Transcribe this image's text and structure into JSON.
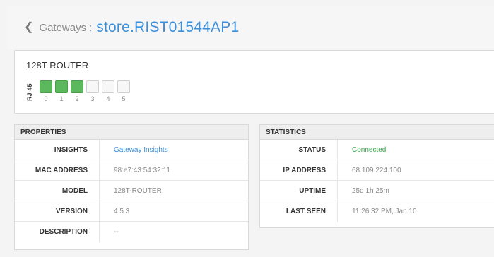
{
  "header": {
    "breadcrumb": "Gateways",
    "separator": ":",
    "gateway_name": "store.RIST01544AP1"
  },
  "router": {
    "title": "128T-ROUTER",
    "interface_label": "RJ-45",
    "ports": [
      {
        "number": "0",
        "status": "up"
      },
      {
        "number": "1",
        "status": "up"
      },
      {
        "number": "2",
        "status": "up"
      },
      {
        "number": "3",
        "status": "down"
      },
      {
        "number": "4",
        "status": "down"
      },
      {
        "number": "5",
        "status": "down"
      }
    ]
  },
  "properties": {
    "title": "PROPERTIES",
    "rows": [
      {
        "key": "INSIGHTS",
        "value": "Gateway Insights"
      },
      {
        "key": "MAC ADDRESS",
        "value": "98:e7:43:54:32:11"
      },
      {
        "key": "MODEL",
        "value": "128T-ROUTER"
      },
      {
        "key": "VERSION",
        "value": "4.5.3"
      },
      {
        "key": "DESCRIPTION",
        "value": "--"
      }
    ]
  },
  "statistics": {
    "title": "STATISTICS",
    "rows": [
      {
        "key": "STATUS",
        "value": "Connected"
      },
      {
        "key": "IP ADDRESS",
        "value": "68.109.224.100"
      },
      {
        "key": "UPTIME",
        "value": "25d 1h 25m"
      },
      {
        "key": "LAST SEEN",
        "value": "11:26:32 PM, Jan 10"
      }
    ]
  },
  "colors": {
    "accent": "#3d8fd8",
    "port_up": "#5cb85c",
    "status_ok": "#3aa64a"
  }
}
